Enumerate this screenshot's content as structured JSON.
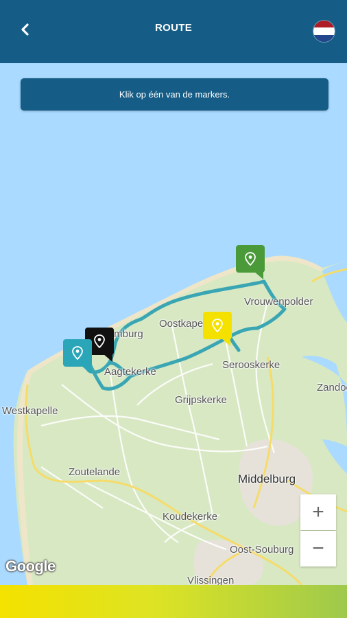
{
  "header": {
    "title": "ROUTE",
    "back_icon": "chevron-left-icon",
    "flag_icon": "netherlands-flag-icon",
    "flag_colors": [
      "#ae1c28",
      "#ffffff",
      "#21468b"
    ],
    "background": "#155d86"
  },
  "banner": {
    "text": "Klik op één van de markers."
  },
  "map": {
    "places": [
      {
        "name": "Vrouwenpolder"
      },
      {
        "name": "Oostkapelle"
      },
      {
        "name": "Domburg"
      },
      {
        "name": "Serooskerke"
      },
      {
        "name": "Aagtekerke"
      },
      {
        "name": "Zandoo"
      },
      {
        "name": "Grijpskerke"
      },
      {
        "name": "Westkapelle"
      },
      {
        "name": "Zoutelande"
      },
      {
        "name": "Middelburg"
      },
      {
        "name": "Koudekerke"
      },
      {
        "name": "Oost-Souburg"
      },
      {
        "name": "Vlissingen"
      }
    ],
    "markers": [
      {
        "color": "#4a9a3a",
        "icon": "location-pin-icon"
      },
      {
        "color": "#f5e100",
        "icon": "location-pin-icon"
      },
      {
        "color": "#111111",
        "icon": "location-pin-icon"
      },
      {
        "color": "#2aa6b8",
        "icon": "location-pin-icon"
      }
    ],
    "route_color": "#3aa6b4",
    "zoom_in_label": "+",
    "zoom_out_label": "−",
    "attribution": "Google"
  },
  "footer": {
    "gradient": [
      "#f4e200",
      "#9ec94c"
    ]
  }
}
